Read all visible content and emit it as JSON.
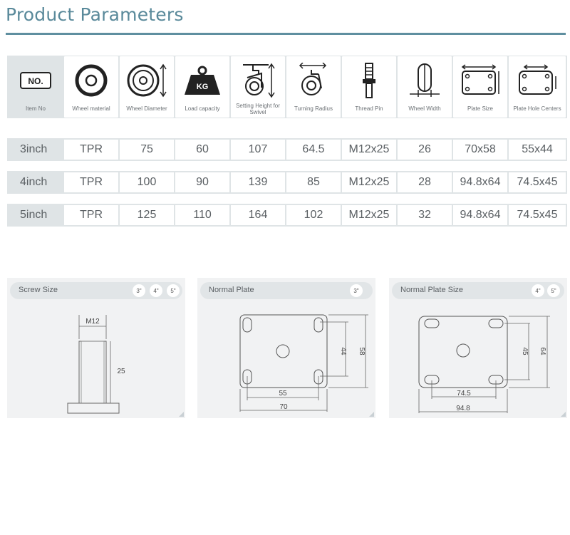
{
  "title": "Product Parameters",
  "columns": [
    {
      "label": "Item No",
      "icon": "no-badge-icon"
    },
    {
      "label": "Wheel material",
      "icon": "wheel-icon"
    },
    {
      "label": "Wheel Diameter",
      "icon": "wheel-diameter-icon"
    },
    {
      "label": "Load capacity",
      "icon": "kg-weight-icon"
    },
    {
      "label": "Setting Height for Swivel",
      "icon": "swivel-caster-icon"
    },
    {
      "label": "Turning Radius",
      "icon": "turning-radius-icon"
    },
    {
      "label": "Thread Pin",
      "icon": "thread-pin-icon"
    },
    {
      "label": "Wheel Width",
      "icon": "wheel-width-icon"
    },
    {
      "label": "Plate Size",
      "icon": "plate-size-icon"
    },
    {
      "label": "Plate Hole Centers",
      "icon": "plate-hole-centers-icon"
    }
  ],
  "badge": "NO.",
  "kg": "KG",
  "rows": [
    [
      "3inch",
      "TPR",
      "75",
      "60",
      "107",
      "64.5",
      "M12x25",
      "26",
      "70x58",
      "55x44"
    ],
    [
      "4inch",
      "TPR",
      "100",
      "90",
      "139",
      "85",
      "M12x25",
      "28",
      "94.8x64",
      "74.5x45"
    ],
    [
      "5inch",
      "TPR",
      "125",
      "110",
      "164",
      "102",
      "M12x25",
      "32",
      "94.8x64",
      "74.5x45"
    ]
  ],
  "panels": {
    "screw": {
      "title": "Screw Size",
      "chips": [
        "3\"",
        "4\"",
        "5\""
      ],
      "m12": "M12",
      "len": "25"
    },
    "normal": {
      "title": "Normal Plate",
      "chips": [
        "3\""
      ],
      "w_holes": "55",
      "w_plate": "70",
      "h_holes": "44",
      "h_plate": "58"
    },
    "normal_size": {
      "title": "Normal Plate Size",
      "chips": [
        "4\"",
        "5\""
      ],
      "w_holes": "74.5",
      "w_plate": "94.8",
      "h_holes": "45",
      "h_plate": "64"
    }
  }
}
